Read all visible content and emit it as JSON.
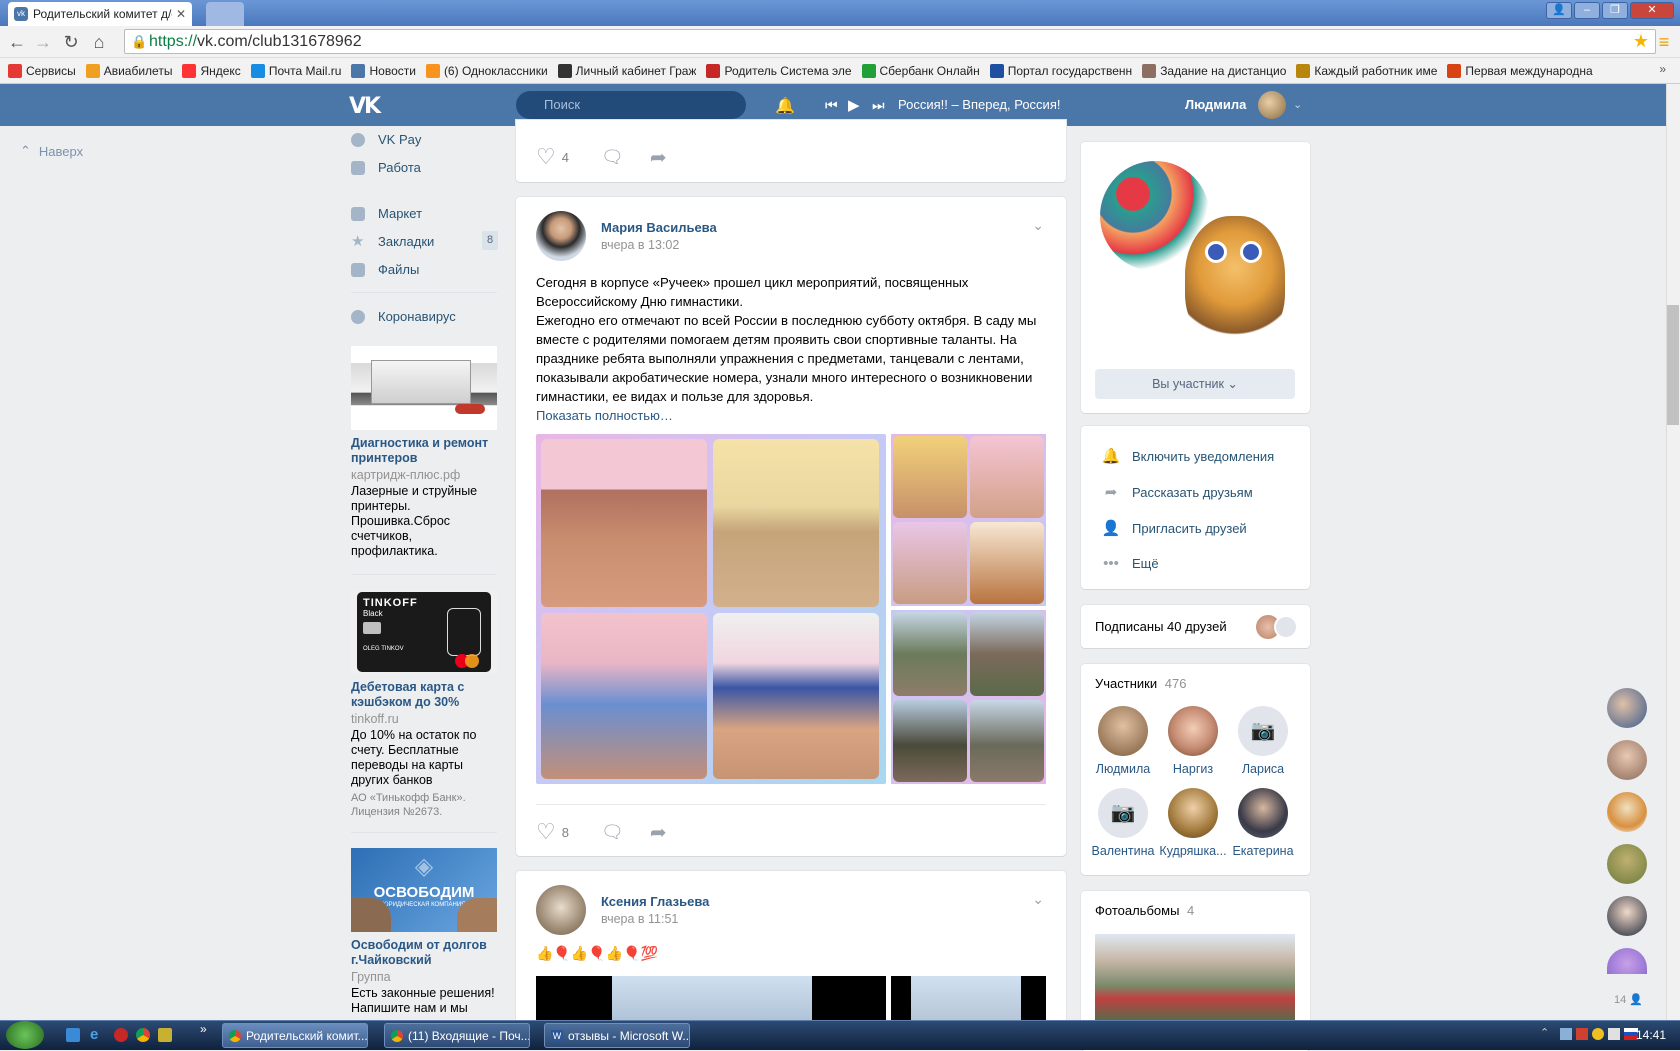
{
  "browser": {
    "tab_title": "Родительский комитет д/с",
    "url_scheme": "https://",
    "url_rest": "vk.com/club131678962",
    "bookmarks": [
      {
        "label": "Сервисы",
        "color": "#e53935"
      },
      {
        "label": "Авиабилеты",
        "color": "#f0a020"
      },
      {
        "label": "Яндекс",
        "color": "#ff3333"
      },
      {
        "label": "Почта Mail.ru",
        "color": "#168de2"
      },
      {
        "label": "Новости",
        "color": "#4a76a8"
      },
      {
        "label": "(6) Одноклассники",
        "color": "#f7931e"
      },
      {
        "label": "Личный кабинет Граж",
        "color": "#333333"
      },
      {
        "label": "Родитель Система эле",
        "color": "#c62828"
      },
      {
        "label": "Сбербанк Онлайн",
        "color": "#21a038"
      },
      {
        "label": "Портал государственн",
        "color": "#1e4fa0"
      },
      {
        "label": "Задание на дистанцио",
        "color": "#8d6e63"
      },
      {
        "label": "Каждый работник име",
        "color": "#b8860b"
      },
      {
        "label": "Первая международна",
        "color": "#d84315"
      }
    ]
  },
  "vk_header": {
    "logo": "VK",
    "search_placeholder": "Поиск",
    "now_playing": "Россия!! – Вперед, Россия!",
    "user_name": "Людмила"
  },
  "left": {
    "back_to_top": "Наверх",
    "menu": [
      {
        "label": "VK Pay"
      },
      {
        "label": "Работа"
      },
      {
        "label": "Маркет"
      },
      {
        "label": "Закладки",
        "count": "8"
      },
      {
        "label": "Файлы"
      },
      {
        "label": "Коронавирус"
      }
    ],
    "ads": [
      {
        "title": "Диагностика и ремонт принтеров",
        "url": "картридж-плюс.рф",
        "text": "Лазерные и струйные принтеры. Прошивка.Сброс счетчиков, профилактика."
      },
      {
        "title": "Дебетовая карта с кэшбэком до 30%",
        "url": "tinkoff.ru",
        "text": "До 10% на остаток по счету. Бесплатные переводы на карты других банков",
        "small": "АО «Тинькофф Банк». Лицензия №2673.",
        "card_brand": "TINKOFF",
        "card_sub": "Black",
        "card_holder": "OLEG TINKOV"
      },
      {
        "title": "Освободим от долгов г.Чайковский",
        "url": "Группа",
        "text": "Есть законные решения! Напишите нам и мы",
        "img_text": "ОСВОБОДИМ",
        "img_sub": "ЮРИДИЧЕСКАЯ КОМПАНИЯ"
      }
    ]
  },
  "feed": {
    "prev_post": {
      "likes": "4"
    },
    "post": {
      "author": "Мария Васильева",
      "time": "вчера в 13:02",
      "text": "Сегодня в корпусе «Ручеек» прошел цикл мероприятий, посвященных Всероссийскому Дню гимнастики.\nЕжегодно его отмечают по всей России в последнюю субботу октября. В саду мы вместе с родителями помогаем детям проявить свои спортивные таланты. На празднике ребята выполняли упражнения с предметами, танцевали с лентами, показывали акробатические номера, узнали много интересного о возникновении гимнастики, ее видах и пользе для здоровья.",
      "show_more": "Показать полностью…",
      "likes": "8"
    },
    "next_post": {
      "author": "Ксения Глазьева",
      "time": "вчера в 11:51",
      "text": "👍🎈👍🎈👍🎈💯"
    }
  },
  "right": {
    "membership_button": "Вы участник",
    "actions": [
      {
        "label": "Включить уведомления",
        "icon": "bell-icon"
      },
      {
        "label": "Рассказать друзьям",
        "icon": "share-icon"
      },
      {
        "label": "Пригласить друзей",
        "icon": "add-user-icon"
      },
      {
        "label": "Ещё",
        "icon": "more-icon"
      }
    ],
    "friends_subscribed": "Подписаны 40 друзей",
    "members_title": "Участники",
    "members_count": "476",
    "members": [
      {
        "name": "Людмила"
      },
      {
        "name": "Наргиз"
      },
      {
        "name": "Лариса"
      },
      {
        "name": "Валентина"
      },
      {
        "name": "Кудряшка..."
      },
      {
        "name": "Екатерина"
      }
    ],
    "albums_title": "Фотоальбомы",
    "albums_count": "4"
  },
  "chat_sidebar": {
    "online_count": "14"
  },
  "taskbar": {
    "tasks": [
      {
        "label": "Родительский комит..."
      },
      {
        "label": "(11) Входящие - Поч..."
      },
      {
        "label": "отзывы - Microsoft W..."
      }
    ],
    "clock": "14:41"
  }
}
